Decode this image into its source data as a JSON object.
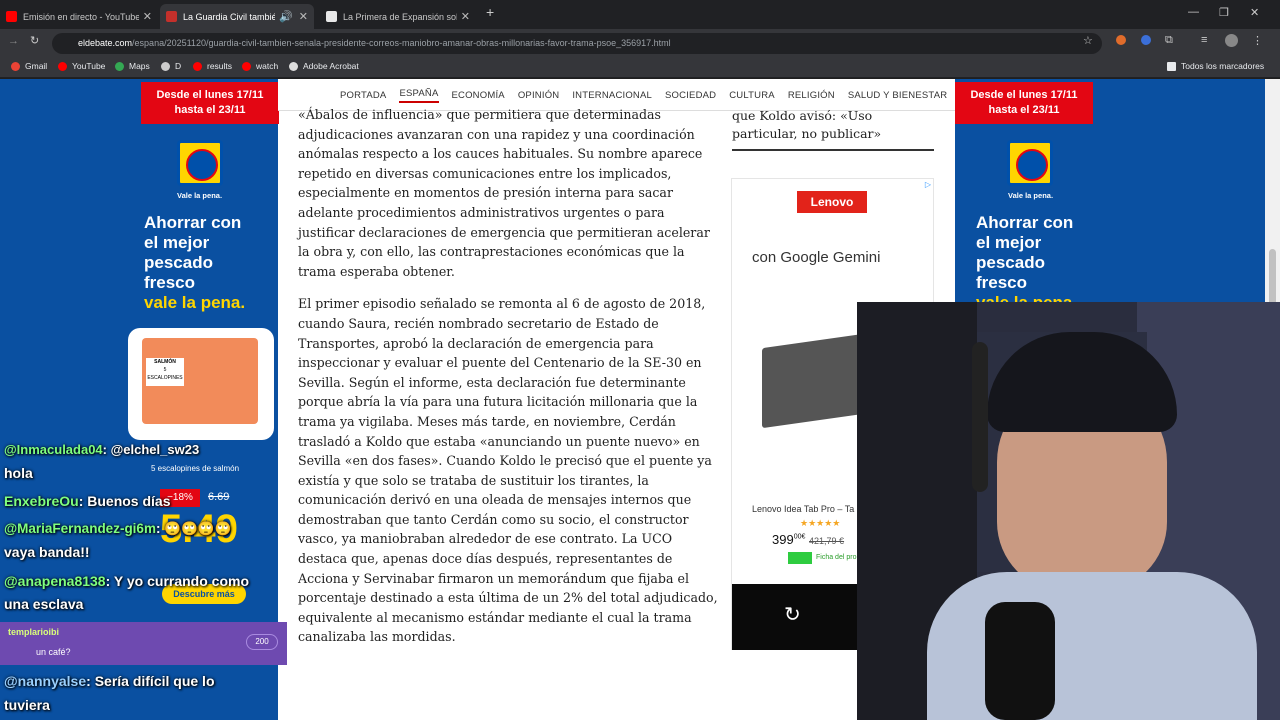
{
  "tabs": [
    {
      "title": "Emisión en directo - YouTube S",
      "color": "#ff0000",
      "active": false
    },
    {
      "title": "La Guardia Civil también se",
      "color": "#c4302b",
      "active": true
    },
    {
      "title": "La Primera de Expansión sobre",
      "color": "#e8e8e8",
      "active": false
    }
  ],
  "address": {
    "domain": "eldebate.com",
    "path": "/espana/20251120/guardia-civil-tambien-senala-presidente-correos-maniobro-amanar-obras-millonarias-favor-trama-psoe_356917.html"
  },
  "bookmarks": [
    "Gmail",
    "YouTube",
    "Maps",
    "D",
    "results",
    "watch",
    "Adobe Acrobat"
  ],
  "bookmarks_right": "Todos los marcadores",
  "ad_lidl": {
    "header": "Desde el lunes 17/11 hasta el 23/11",
    "tagline": "Vale la pena.",
    "headline_lines": [
      "Ahorrar con",
      "el mejor",
      "pescado",
      "fresco"
    ],
    "headline_yellow": "vale la pena.",
    "product": "5 escalopines de salmón",
    "price_old": "6.69",
    "price_new": "5.49",
    "cta": "Descubre más"
  },
  "nav": [
    "PORTADA",
    "ESPAÑA",
    "ECONOMÍA",
    "OPINIÓN",
    "INTERNACIONAL",
    "SOCIEDAD",
    "CULTURA",
    "RELIGIÓN",
    "SALUD Y BIENESTAR"
  ],
  "article": {
    "p1": "«Ábalos de influencia» que permitiera que determinadas adjudicaciones avanzaran con una rapidez y una coordinación anómalas respecto a los cauces habituales. Su nombre aparece repetido en diversas comunicaciones entre los implicados, especialmente en momentos de presión interna para sacar adelante procedimientos administrativos urgentes o para justificar declaraciones de emergencia que permitieran acelerar la obra y, con ello, las contraprestaciones económicas que la trama esperaba obtener.",
    "p2": "El primer episodio señalado se remonta al 6 de agosto de 2018, cuando Saura, recién nombrado secretario de Estado de Transportes, aprobó la declaración de emergencia para inspeccionar y evaluar el puente del Centenario de la SE-30 en Sevilla. Según el informe, esta declaración fue determinante porque abría la vía para una futura licitación millonaria que la trama ya vigilaba. Meses más tarde, en noviembre, Cerdán trasladó a Koldo que estaba «anunciando un puente nuevo» en Sevilla «en dos fases». Cuando Koldo le precisó que el puente ya existía y que solo se trataba de sustituir los tirantes, la comunicación derivó en una oleada de mensajes internos que demostraban que tanto Cerdán como su socio, el constructor vasco, ya maniobraban alrededor de ese contrato. La UCO destaca que, apenas doce días después, representantes de Acciona y Servinabar firmaron un memorándum que fijaba el porcentaje destinado a esta última de un 2% del total adjudicado, equivalente al mecanismo estándar mediante el cual la trama canalizaba las mordidas."
  },
  "sidebar_snippet": "que Koldo avisó: «Uso particular, no publicar»",
  "ad_lenovo": {
    "brand": "Lenovo",
    "slogan": "con Google Gemini",
    "product": "Lenovo Idea Tab Pro – Ta",
    "price": "399",
    "cents": "00€",
    "old_price": "421,79 €",
    "badge": "Ficha del pro"
  },
  "chat": [
    {
      "user": "@Inmaculada04",
      "text": ": @elchel_sw23",
      "extra": "hola"
    },
    {
      "user": "EnxebreOu",
      "text": ": Buenos días"
    },
    {
      "user": "@MariaFernandez-gi6m",
      "text": ": 🙄🙄🙄🙄",
      "extra": "vaya banda!!"
    },
    {
      "user": "@anapena8138",
      "text": ": Y yo currando como",
      "extra": "una esclava"
    },
    {
      "user": "@nannyalse",
      "text": ": Sería difícil que lo",
      "extra": "tuviera"
    }
  ],
  "superchat": {
    "user": "templarioibi",
    "text": "un café?",
    "amount": "200"
  }
}
